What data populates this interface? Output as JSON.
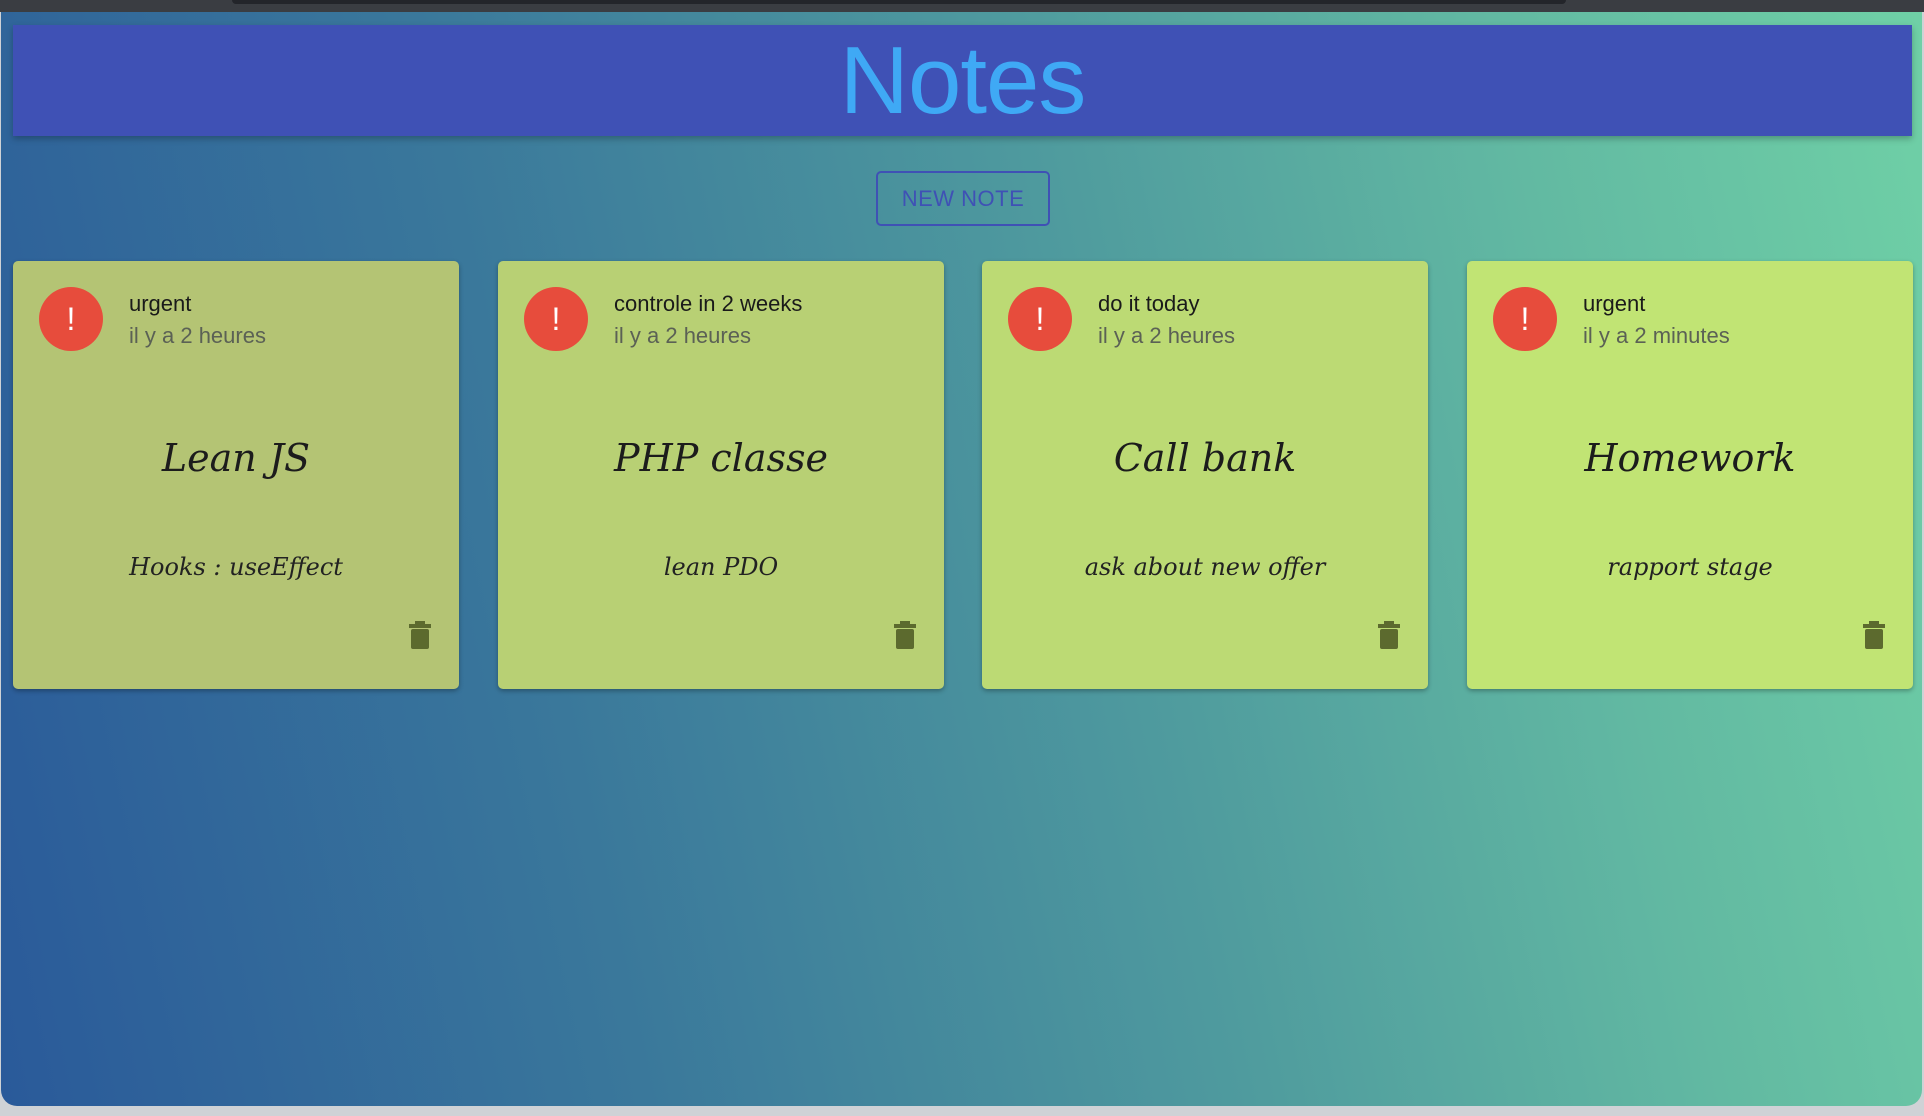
{
  "app": {
    "title": "Notes",
    "new_note_label": "NEW NOTE"
  },
  "colors": {
    "header_bg": "#3f51b5",
    "title_color": "#3fa9f5",
    "alert_red": "#e74c3c"
  },
  "notes": [
    {
      "tag": "urgent",
      "time": "il y a 2 heures",
      "title": "Lean JS",
      "body": "Hooks : useEffect",
      "alert_symbol": "!",
      "card_color": "#b4c474"
    },
    {
      "tag": "controle in 2 weeks",
      "time": "il y a 2 heures",
      "title": "PHP classe",
      "body": "lean PDO",
      "alert_symbol": "!",
      "card_color": "#b8d074"
    },
    {
      "tag": "do it today",
      "time": "il y a 2 heures",
      "title": "Call bank",
      "body": "ask about new offer",
      "alert_symbol": "!",
      "card_color": "#bcda74"
    },
    {
      "tag": "urgent",
      "time": "il y a 2 minutes",
      "title": "Homework",
      "body": "rapport stage",
      "alert_symbol": "!",
      "card_color": "#c1e474"
    }
  ]
}
